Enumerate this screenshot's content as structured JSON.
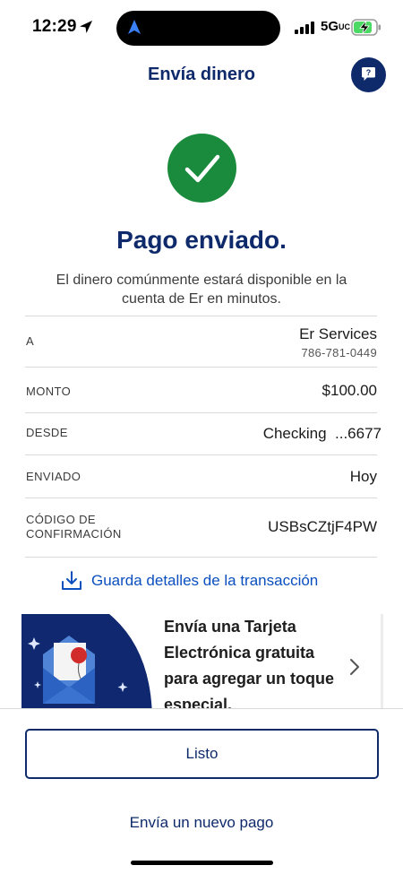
{
  "status_bar": {
    "time": "12:29",
    "network": "5G",
    "network_suffix": "UC",
    "battery_state": "charging"
  },
  "header": {
    "title": "Envía dinero",
    "help_icon": "question-mark-icon"
  },
  "confirmation": {
    "icon": "check-icon",
    "title": "Pago enviado.",
    "message": "El dinero comúnmente estará disponible en la cuenta de Er en minutos."
  },
  "details": {
    "to_label": "A",
    "to_name": "Er Services",
    "to_phone": "786-781-0449",
    "amount_label": "MONTO",
    "amount": "$100.00",
    "from_label": "DESDE",
    "from_account": "Checking  ...6677",
    "sent_label": "ENVIADO",
    "sent_date": "Hoy",
    "code_label_line1": "CÓDIGO DE",
    "code_label_line2": "CONFIRMACIÓN",
    "code": "USBsCZtjF4PW"
  },
  "save_details": {
    "label": "Guarda detalles de la transacción",
    "icon": "download-icon"
  },
  "ecard": {
    "text": "Envía una Tarjeta Electrónica gratuita para agregar un toque especial.",
    "icon": "envelope-balloon-icon"
  },
  "actions": {
    "done_label": "Listo",
    "new_payment_label": "Envía un nuevo pago"
  },
  "colors": {
    "brand_navy": "#0e2a6b",
    "success_green": "#1a8a3c",
    "link_blue": "#0b4fbf"
  }
}
